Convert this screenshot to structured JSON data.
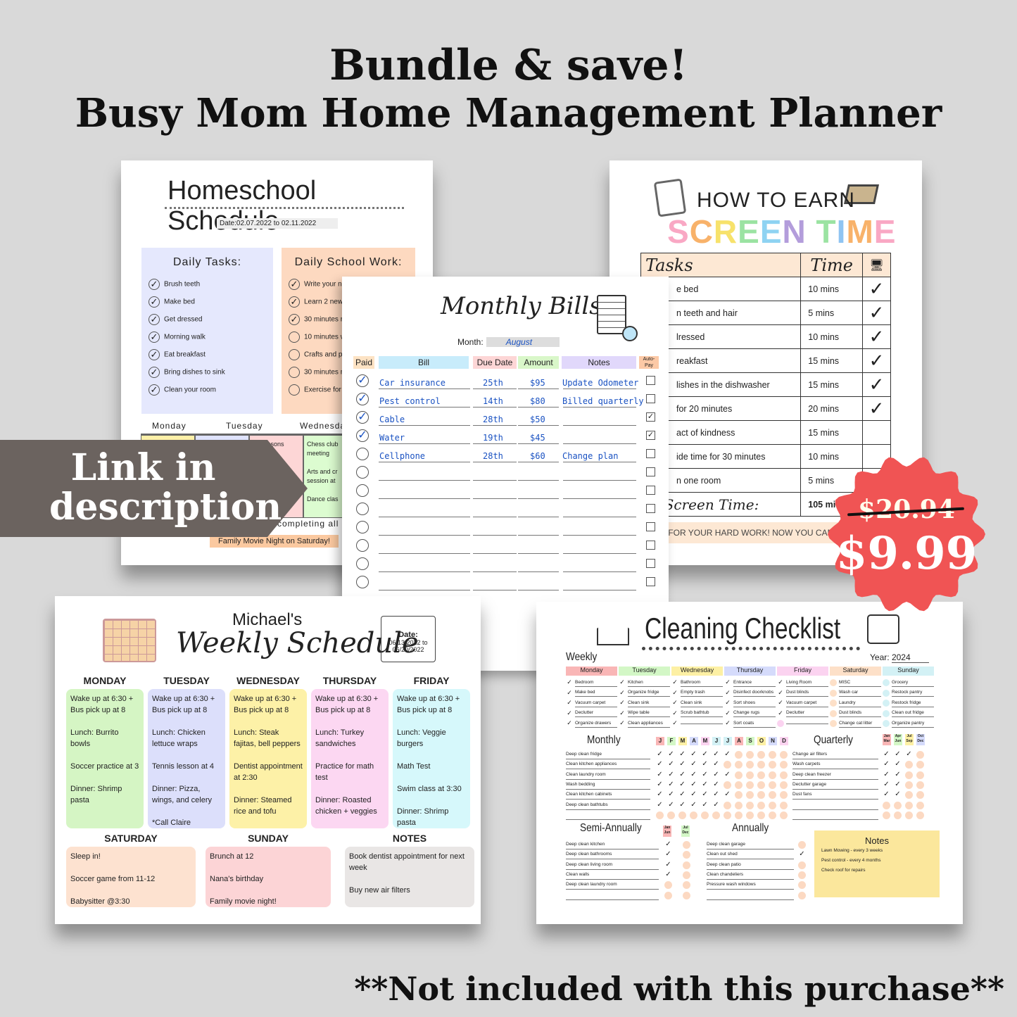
{
  "header": {
    "line1": "Bundle & save!",
    "line2": "Busy Mom Home Management Planner"
  },
  "homeschool": {
    "title": "Homeschool Schedule",
    "date_label": "Date:",
    "date": "02.07.2022 to 02.11.2022",
    "daily_tasks_title": "Daily Tasks:",
    "daily_tasks": [
      {
        "t": "Brush teeth",
        "d": true
      },
      {
        "t": "Make bed",
        "d": true
      },
      {
        "t": "Get dressed",
        "d": true
      },
      {
        "t": "Morning walk",
        "d": true
      },
      {
        "t": "Eat breakfast",
        "d": true
      },
      {
        "t": "Bring dishes to sink",
        "d": true
      },
      {
        "t": "Clean your room",
        "d": true
      }
    ],
    "school_work_title": "Daily School Work:",
    "school_work": [
      {
        "t": "Write your nam",
        "d": true
      },
      {
        "t": "Learn 2 new w",
        "d": true
      },
      {
        "t": "30 minutes re",
        "d": true
      },
      {
        "t": "10 minutes wr",
        "d": false
      },
      {
        "t": "Crafts and pai",
        "d": false
      },
      {
        "t": "30 minutes ma",
        "d": false
      },
      {
        "t": "Exercise for 1",
        "d": false
      }
    ],
    "days": [
      "Monday",
      "Tuesday",
      "Wednesday",
      "Thursd"
    ],
    "cal": [
      {
        "c": "#fdf0a8",
        "t": ""
      },
      {
        "c": "#dfe3fd",
        "t": ""
      },
      {
        "c": "#fdd6d6",
        "t": "nis lessons\n\n        sit"
      },
      {
        "c": "#dcfcd0",
        "t": "Chess club meeting\n\nArts and cr session at\n\nDance clas"
      }
    ],
    "reward": "completing all",
    "reward_note": "Family Movie Night on Saturday!"
  },
  "screen_time": {
    "title_top": "HOW TO EARN",
    "title_main": "SCREEN TIME",
    "headers": [
      "Tasks",
      "Time"
    ],
    "icon": "monitor-icon",
    "rows": [
      {
        "task": "e bed",
        "time": "10 mins",
        "done": true
      },
      {
        "task": "n teeth and hair",
        "time": "5 mins",
        "done": true
      },
      {
        "task": "lressed",
        "time": "10 mins",
        "done": true
      },
      {
        "task": "reakfast",
        "time": "15 mins",
        "done": true
      },
      {
        "task": "lishes in the dishwasher",
        "time": "15 mins",
        "done": true
      },
      {
        "task": "for 20 minutes",
        "time": "20 mins",
        "done": true
      },
      {
        "task": "act of kindness",
        "time": "15 mins",
        "done": false
      },
      {
        "task": "ide time for 30 minutes",
        "time": "10 mins",
        "done": false
      },
      {
        "task": "n one room",
        "time": "5 mins",
        "done": false
      }
    ],
    "total_label": "al Screen Time:",
    "total": "105 mi",
    "thanks": "YOU FOR YOUR HARD WORK! NOW YOU CAN U"
  },
  "bills": {
    "title": "Monthly Bills",
    "month_label": "Month:",
    "month": "August",
    "headers": [
      {
        "t": "Paid",
        "c": "#fde3c4"
      },
      {
        "t": "Bill",
        "c": "#c8ecfb"
      },
      {
        "t": "Due Date",
        "c": "#fdd6d6"
      },
      {
        "t": "Amount",
        "c": "#d9f7c9"
      },
      {
        "t": "Notes",
        "c": "#e1d8fb"
      },
      {
        "t": "Auto-Pay",
        "c": "#fcc9a6"
      }
    ],
    "rows": [
      {
        "paid": true,
        "bill": "Car insurance",
        "due": "25th",
        "amount": "$95",
        "notes": "Update Odometer",
        "auto": false
      },
      {
        "paid": true,
        "bill": "Pest control",
        "due": "14th",
        "amount": "$80",
        "notes": "Billed quarterly",
        "auto": false
      },
      {
        "paid": true,
        "bill": "Cable",
        "due": "28th",
        "amount": "$50",
        "notes": "",
        "auto": true
      },
      {
        "paid": true,
        "bill": "Water",
        "due": "19th",
        "amount": "$45",
        "notes": "",
        "auto": true
      },
      {
        "paid": false,
        "bill": "Cellphone",
        "due": "28th",
        "amount": "$60",
        "notes": "Change plan",
        "auto": false
      }
    ],
    "empty_rows": 7
  },
  "weekly": {
    "name": "Michael's",
    "title": "Weekly Schedule",
    "date_label": "Date:",
    "date": "06/13/2022 to 06/20/2022",
    "days": [
      {
        "d": "MONDAY",
        "c": "#d5f5c4",
        "items": [
          "Wake up at 6:30 + Bus pick up at 8",
          "Lunch: Burrito bowls",
          "Soccer practice at 3",
          "Dinner: Shrimp pasta"
        ]
      },
      {
        "d": "TUESDAY",
        "c": "#dcdffb",
        "items": [
          "Wake up at 6:30 + Bus pick up at 8",
          "Lunch: Chicken lettuce wraps",
          "Tennis lesson at 4",
          "Dinner: Pizza, wings, and celery",
          "*Call Claire"
        ]
      },
      {
        "d": "WEDNESDAY",
        "c": "#fdf1a7",
        "items": [
          "Wake up at 6:30 + Bus pick up at 8",
          "Lunch: Steak fajitas, bell peppers",
          "Dentist appointment at 2:30",
          "Dinner: Steamed rice and tofu"
        ]
      },
      {
        "d": "THURSDAY",
        "c": "#fcd7f2",
        "items": [
          "Wake up at 6:30 + Bus pick up at 8",
          "Lunch: Turkey sandwiches",
          "Practice for math test",
          "Dinner: Roasted chicken + veggies"
        ]
      },
      {
        "d": "FRIDAY",
        "c": "#d6f8fb",
        "items": [
          "Wake up at 6:30 + Bus pick up at 8",
          "Lunch: Veggie burgers",
          "Math Test",
          "Swim class at 3:30",
          "Dinner: Shrimp pasta"
        ]
      }
    ],
    "bottom": [
      {
        "d": "SATURDAY",
        "c": "#fde2d0",
        "items": [
          "Sleep in!",
          "Soccer game from 11-12",
          "Babysitter @3:30"
        ]
      },
      {
        "d": "SUNDAY",
        "c": "#fcd4d6",
        "items": [
          "Brunch at 12",
          "Nana's birthday",
          "Family movie night!"
        ]
      },
      {
        "d": "NOTES",
        "c": "#e9e6e5",
        "items": [
          "Book dentist appointment for next week",
          "Buy new air filters"
        ]
      }
    ]
  },
  "cleaning": {
    "title": "Cleaning Checklist",
    "year_label": "Year:",
    "year": "2024",
    "weekly_label": "Weekly",
    "weekly": [
      {
        "d": "Monday",
        "c": "#f9b6b6",
        "items": [
          "Bedroom",
          "Make bed",
          "Vacuum carpet",
          "Declutter",
          "Organize drawers"
        ],
        "done": [
          1,
          1,
          1,
          1,
          1
        ]
      },
      {
        "d": "Tuesday",
        "c": "#d3f7c6",
        "items": [
          "Kitchen",
          "Organize fridge",
          "Clean sink",
          "Wipe table",
          "Clean appliances"
        ],
        "done": [
          1,
          1,
          1,
          1,
          1
        ]
      },
      {
        "d": "Wednesday",
        "c": "#fdf0a4",
        "items": [
          "Bathroom",
          "Empty trash",
          "Clean sink",
          "Scrub bathtub",
          ""
        ],
        "done": [
          1,
          1,
          1,
          1,
          1
        ]
      },
      {
        "d": "Thursday",
        "c": "#d5dbfb",
        "items": [
          "Entrance",
          "Disinfect doorknobs",
          "Sort shoes",
          "Change rugs",
          "Sort coats"
        ],
        "done": [
          1,
          1,
          1,
          1,
          1
        ]
      },
      {
        "d": "Friday",
        "c": "#fbd3f0",
        "items": [
          "Living Room",
          "Dust blinds",
          "Vacuum carpet",
          "Declutter",
          ""
        ],
        "done": [
          1,
          1,
          1,
          1,
          0
        ]
      },
      {
        "d": "Saturday",
        "c": "#fde0c8",
        "items": [
          "MISC",
          "Wash car",
          "Laundry",
          "Dust blinds",
          "Change cat litter"
        ],
        "done": [
          0,
          0,
          0,
          0,
          0
        ]
      },
      {
        "d": "Sunday",
        "c": "#d3f1f5",
        "items": [
          "Grocery",
          "Restock pantry",
          "Restock fridge",
          "Clean out fridge",
          "Organize pantry"
        ],
        "done": [
          0,
          0,
          0,
          0,
          0
        ]
      }
    ],
    "monthly_label": "Monthly",
    "months": [
      "J",
      "F",
      "M",
      "A",
      "M",
      "J",
      "J",
      "A",
      "S",
      "O",
      "N",
      "D"
    ],
    "monthly": [
      {
        "t": "Deep clean fridge",
        "n": 7
      },
      {
        "t": "Clean kitchen appliances",
        "n": 6
      },
      {
        "t": "Clean laundry room",
        "n": 7
      },
      {
        "t": "Wash bedding",
        "n": 6
      },
      {
        "t": "Clean kitchen cabinets",
        "n": 7
      },
      {
        "t": "Deep clean bathtubs",
        "n": 6
      },
      {
        "t": "",
        "n": 0
      }
    ],
    "quarterly_label": "Quarterly",
    "quarters": [
      "Jan Mar",
      "Apr Jun",
      "Jul Sep",
      "Oct Dec"
    ],
    "quarterly": [
      {
        "t": "Change air filters",
        "n": 3
      },
      {
        "t": "Wash carpets",
        "n": 2
      },
      {
        "t": "Deep clean freezer",
        "n": 2
      },
      {
        "t": "Declutter garage",
        "n": 2
      },
      {
        "t": "Dust fans",
        "n": 2
      },
      {
        "t": "",
        "n": 0
      },
      {
        "t": "",
        "n": 0
      }
    ],
    "semi_label": "Semi-Annually",
    "halves": [
      "Jan Jun",
      "Jul Dec"
    ],
    "semi": [
      {
        "t": "Deep clean kitchen",
        "n": 1
      },
      {
        "t": "Deep clean bathrooms",
        "n": 1
      },
      {
        "t": "Deep clean living room",
        "n": 1
      },
      {
        "t": "Clean walls",
        "n": 1
      },
      {
        "t": "Deep clean laundry room",
        "n": 0
      },
      {
        "t": "",
        "n": 0
      }
    ],
    "annual_label": "Annually",
    "annual": [
      {
        "t": "Deep clean garage",
        "d": false
      },
      {
        "t": "Clean out shed",
        "d": true
      },
      {
        "t": "Deep clean patio",
        "d": false
      },
      {
        "t": "Clean chandeliers",
        "d": false
      },
      {
        "t": "Pressure wash windows",
        "d": false
      },
      {
        "t": "",
        "d": false
      }
    ],
    "notes_label": "Notes",
    "notes": [
      "Lawn Mowing - every 3 weeks",
      "Pest control - every 4 months",
      "Check roof for repairs"
    ]
  },
  "banner": {
    "line1": "Link in",
    "line2": "description"
  },
  "price": {
    "old": "$20.94",
    "new": "$9.99",
    "color": "#f05454"
  },
  "footer": "**Not included with this purchase**"
}
